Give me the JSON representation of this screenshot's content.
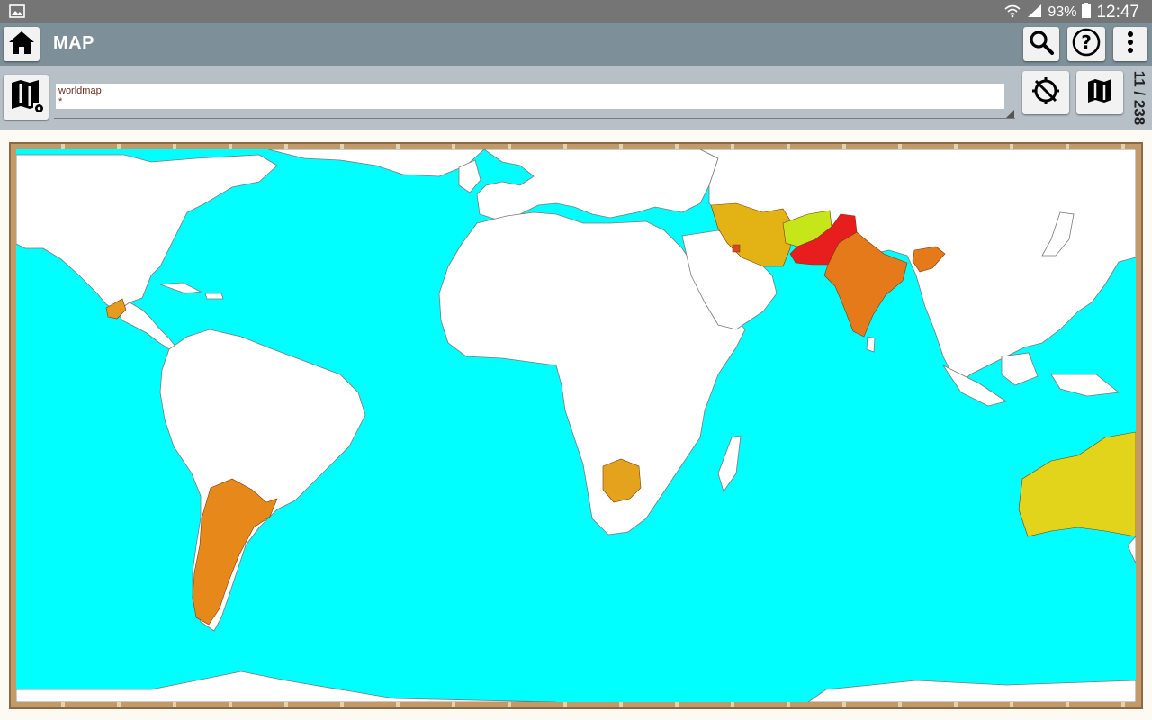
{
  "status_bar": {
    "battery_percent": "93%",
    "time": "12:47",
    "icons": [
      "picture-icon",
      "wifi-icon",
      "signal-icon",
      "battery-icon"
    ]
  },
  "app_bar": {
    "title": "MAP",
    "home_icon": "home-icon",
    "actions": [
      "search-icon",
      "help-icon",
      "more-vert-icon"
    ]
  },
  "toolbar": {
    "map_settings_icon": "map-settings-icon",
    "map_name": "worldmap",
    "filter": "*",
    "locate_icon": "location-off-icon",
    "map_icon": "map-icon",
    "counter": "11 / 238"
  },
  "map": {
    "ocean_color": "#00ffff",
    "land_color": "#ffffff",
    "highlighted_regions": [
      {
        "name": "Guatemala",
        "color": "#e69a20"
      },
      {
        "name": "Argentina",
        "color": "#e6891a"
      },
      {
        "name": "Botswana",
        "color": "#e5a21d"
      },
      {
        "name": "Iran",
        "color": "#e3b215"
      },
      {
        "name": "Afghanistan",
        "color": "#c6e61a"
      },
      {
        "name": "Pakistan",
        "color": "#e81e1e"
      },
      {
        "name": "India",
        "color": "#e57a1a"
      },
      {
        "name": "Bangladesh",
        "color": "#e57a1a"
      },
      {
        "name": "Kuwait",
        "color": "#d84a1a"
      },
      {
        "name": "Australia",
        "color": "#e2d41a"
      }
    ]
  }
}
